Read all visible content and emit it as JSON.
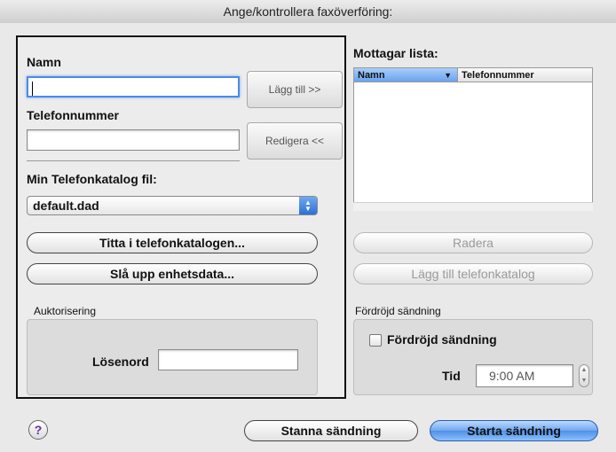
{
  "window": {
    "title": "Ange/kontrollera faxöverföring:"
  },
  "left": {
    "name_label": "Namn",
    "name_value": "",
    "phone_label": "Telefonnummer",
    "phone_value": "",
    "add_button": "Lägg till >>",
    "edit_button": "Redigera <<",
    "catalog_label": "Min Telefonkatalog fil:",
    "catalog_value": "default.dad",
    "browse_button": "Titta i telefonkatalogen...",
    "lookup_button": "Slå upp enhetsdata...",
    "auth_group": "Auktorisering",
    "password_label": "Lösenord",
    "password_value": ""
  },
  "right": {
    "list_label": "Mottagar lista:",
    "columns": [
      "Namn",
      "Telefonnummer"
    ],
    "delete_button": "Radera",
    "add_to_catalog_button": "Lägg till telefonkatalog",
    "delay_group": "Fördröjd sändning",
    "delay_checkbox_label": "Fördröjd sändning",
    "delay_checked": false,
    "time_label": "Tid",
    "time_value": "9:00 AM"
  },
  "footer": {
    "help": "?",
    "stop_button": "Stanna sändning",
    "start_button": "Starta sändning"
  },
  "icons": {
    "help": "help-icon",
    "sort": "sort-down-icon",
    "stepper": "stepper-icon"
  }
}
